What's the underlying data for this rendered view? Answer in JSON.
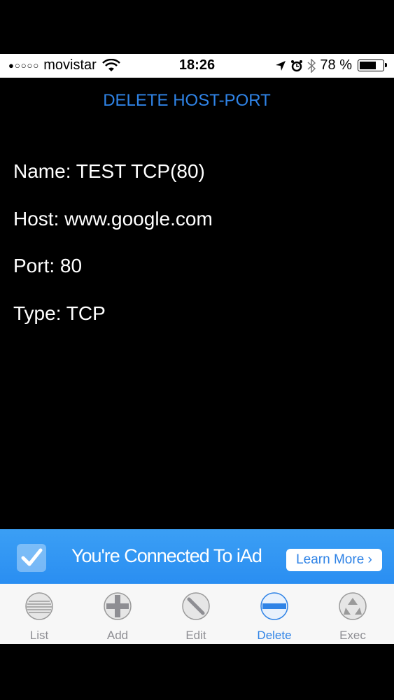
{
  "status_bar": {
    "signal": "●○○○○",
    "carrier": "movistar",
    "time": "18:26",
    "battery": "78 %",
    "battery_level": 0.78
  },
  "page": {
    "title": "DELETE HOST-PORT",
    "name": "Name: TEST TCP(80)",
    "host": "Host: www.google.com",
    "port": "Port: 80",
    "type": "Type: TCP"
  },
  "ad": {
    "text": "You're Connected To iAd",
    "button": "Learn More ›"
  },
  "tabs": [
    {
      "label": "List",
      "icon": "list-icon"
    },
    {
      "label": "Add",
      "icon": "plus-icon"
    },
    {
      "label": "Edit",
      "icon": "pencil-icon"
    },
    {
      "label": "Delete",
      "icon": "minus-icon",
      "active": true
    },
    {
      "label": "Exec",
      "icon": "recycle-icon"
    }
  ],
  "colors": {
    "accent": "#2f83e6",
    "background": "#000000",
    "ad_banner": "#3b9ff4"
  }
}
